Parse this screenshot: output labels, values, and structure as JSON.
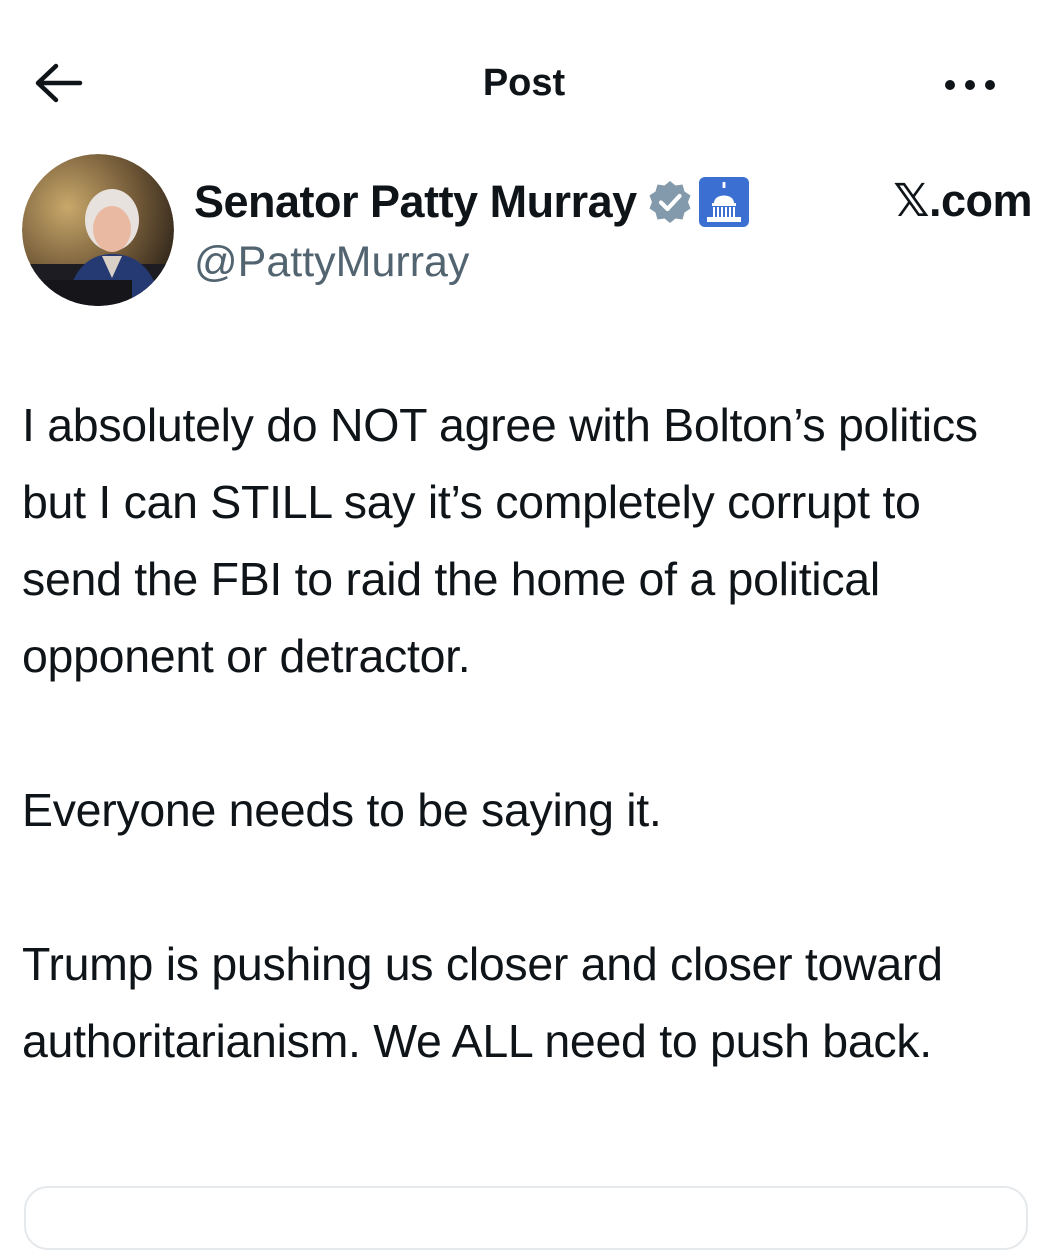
{
  "header": {
    "title": "Post",
    "back_icon": "arrow-left-icon",
    "more_icon": "ellipsis-icon"
  },
  "author": {
    "display_name": "Senator Patty Murray",
    "handle": "@PattyMurray",
    "badges": [
      "verified-badge-icon",
      "us-capitol-icon"
    ],
    "watermark": "𝕏.com"
  },
  "tweet": {
    "paragraphs": [
      "I absolutely do NOT agree with Bolton’s politics but I can STILL say it’s completely corrupt to send the FBI to raid the home of a political opponent or detractor.",
      "Everyone needs to be saying it.",
      "Trump is pushing us closer and closer toward authoritarianism. We ALL need to push back."
    ]
  },
  "colors": {
    "text": "#0f1419",
    "secondary_text": "#536471",
    "verified_badge": "#829aab",
    "capitol_badge": "#3b6fd1"
  }
}
